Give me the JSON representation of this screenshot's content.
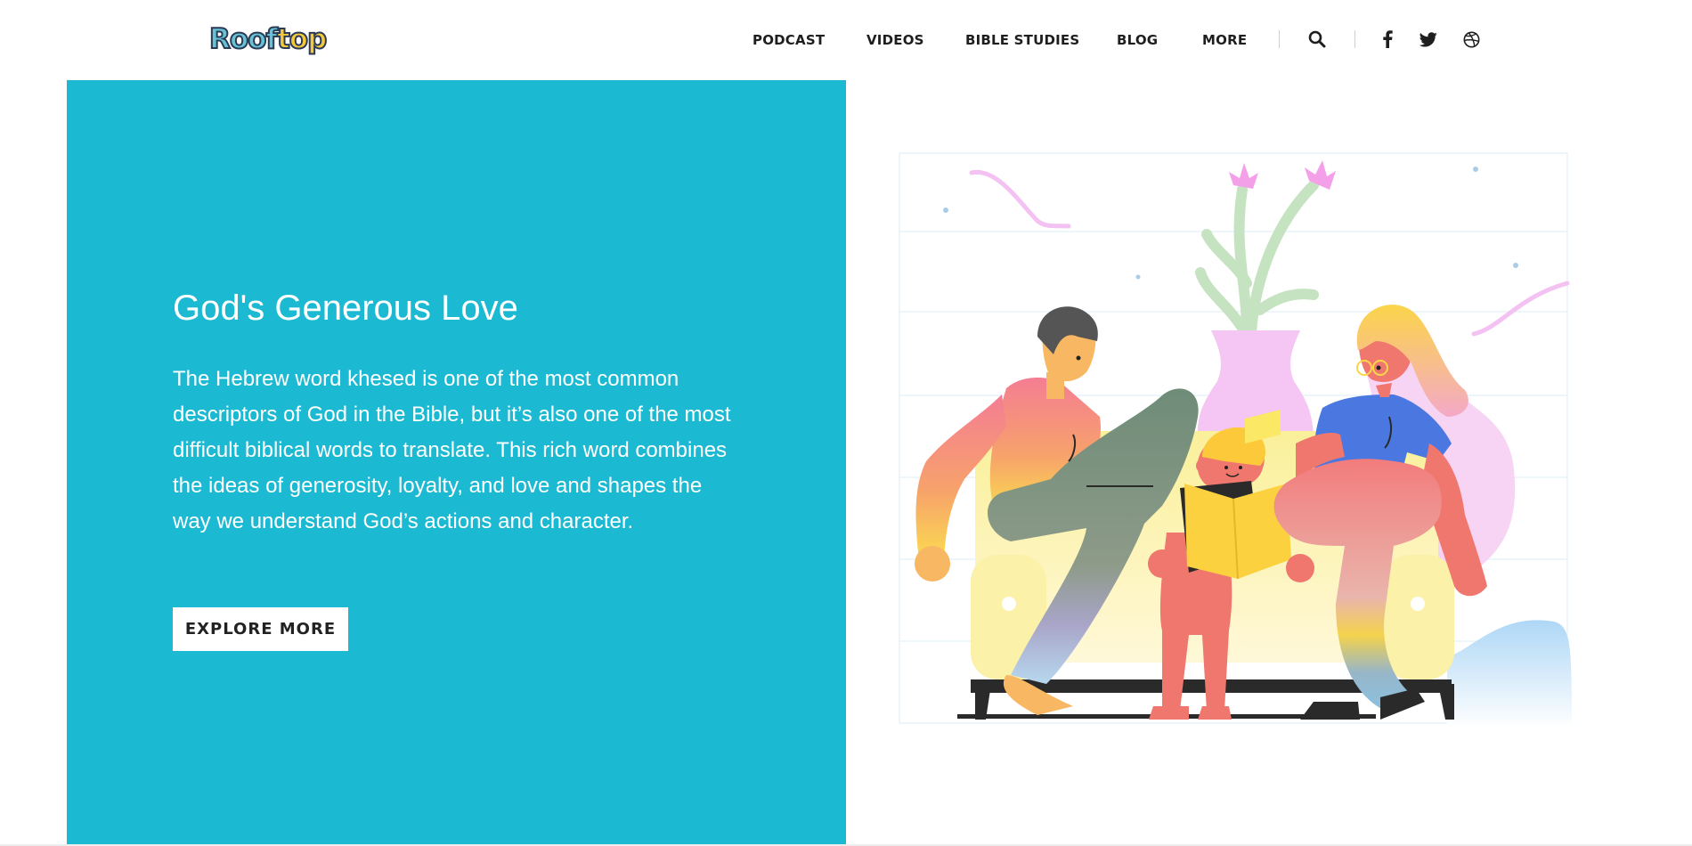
{
  "header": {
    "logo_text_part1": "Roof",
    "logo_text_part2": "top",
    "nav": [
      {
        "label": "PODCAST"
      },
      {
        "label": "VIDEOS"
      },
      {
        "label": "BIBLE STUDIES"
      },
      {
        "label": "BLOG"
      },
      {
        "label": "MORE"
      }
    ],
    "icons": [
      "search-icon",
      "facebook-icon",
      "twitter-icon",
      "dribbble-icon"
    ]
  },
  "hero": {
    "title": "God's Generous Love",
    "text": "The Hebrew word khesed is one of the most common descriptors of God in the Bible, but it’s also one of the most difficult biblical words to translate. This rich word combines the ideas of generosity, loyalty, and love and shapes the way we understand God’s actions and character.",
    "button_label": "EXPLORE MORE"
  },
  "colors": {
    "panel": "#1bb9d2",
    "logo_teal": "#67c2d6",
    "logo_yellow": "#f6c83c"
  }
}
